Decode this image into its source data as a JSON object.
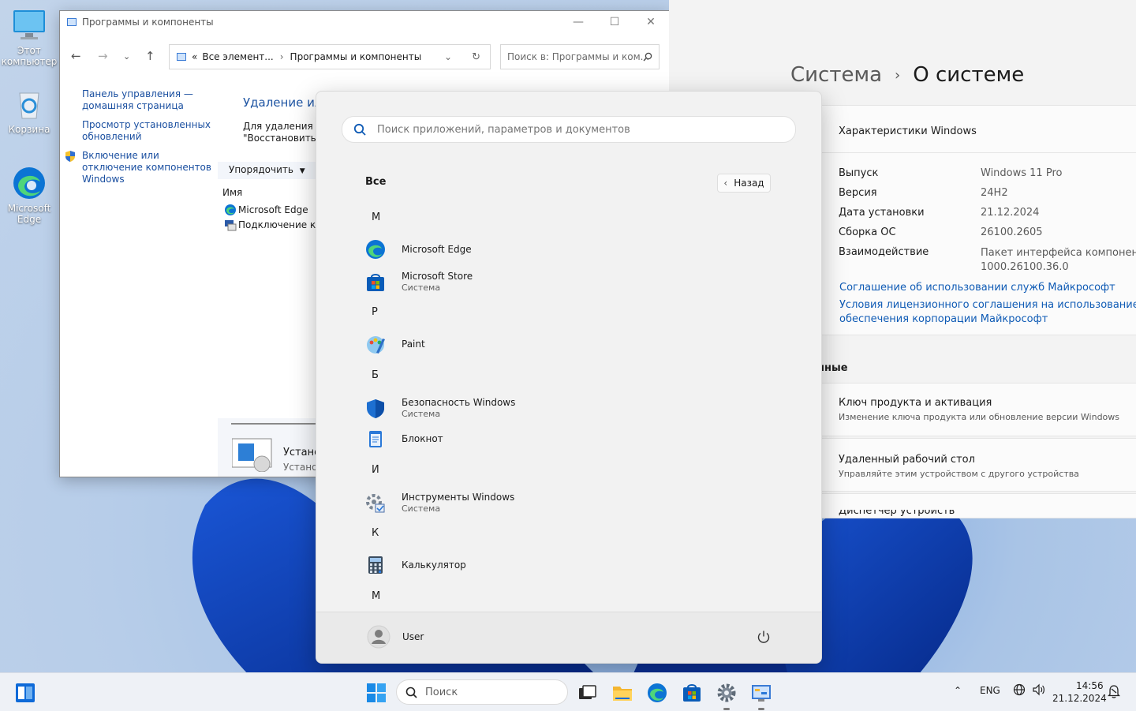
{
  "desktop": {
    "icons": [
      {
        "label": "Этот компьютер",
        "icon": "this-pc-icon"
      },
      {
        "label": "Корзина",
        "icon": "recycle-bin-icon"
      },
      {
        "label": "Microsoft Edge",
        "icon": "edge-icon"
      }
    ]
  },
  "control_panel": {
    "title": "Программы и компоненты",
    "address_prefix": "«",
    "address_crumb1": "Все элемент...",
    "address_crumb2": "Программы и компоненты",
    "search_placeholder": "Поиск в: Программы и ком...",
    "left_links": [
      "Панель управления — домашняя страница",
      "Просмотр установленных обновлений",
      "Включение или отключение компонентов Windows"
    ],
    "main_title": "Удаление или",
    "desc_line1": "Для удаления пр",
    "desc_line2": "\"Восстановить\".",
    "sort_label": "Упорядочить",
    "column_name": "Имя",
    "rows": [
      "Microsoft Edge",
      "Подключение к уд"
    ],
    "bottom_title": "Устано",
    "bottom_sub": "Установ"
  },
  "settings": {
    "crumb_parent": "Система",
    "crumb_current": "О системе",
    "specs_title": "Характеристики Windows",
    "specs": [
      {
        "label": "Выпуск",
        "value": "Windows 11 Pro"
      },
      {
        "label": "Версия",
        "value": "24H2"
      },
      {
        "label": "Дата установки",
        "value": "21.12.2024"
      },
      {
        "label": "Сборка ОС",
        "value": "26100.2605"
      },
      {
        "label": "Взаимодействие",
        "value": "Пакет интерфейса компонентов",
        "value2": "1000.26100.36.0"
      }
    ],
    "link1": "Соглашение об использовании служб Майкрософт",
    "link2a": "Условия лицензионного соглашения на использование пр",
    "link2b": "обеспечения корпорации Майкрософт",
    "related_title": "нные",
    "related": [
      {
        "title": "Ключ продукта и активация",
        "sub": "Изменение ключа продукта или обновление версии Windows"
      },
      {
        "title": "Удаленный рабочий стол",
        "sub": "Управляйте этим устройством с другого устройства"
      },
      {
        "title": "Диспетчер устройств",
        "sub": ""
      }
    ]
  },
  "start_menu": {
    "search_placeholder": "Поиск приложений, параметров и документов",
    "all_label": "Все",
    "back_label": "Назад",
    "letters": [
      "M",
      "P",
      "Б",
      "И",
      "К",
      "М"
    ],
    "apps": [
      {
        "name": "Microsoft Edge",
        "sub": "",
        "icon": "edge-icon"
      },
      {
        "name": "Microsoft Store",
        "sub": "Система",
        "icon": "store-icon"
      },
      {
        "name": "Paint",
        "sub": "",
        "icon": "paint-icon"
      },
      {
        "name": "Безопасность Windows",
        "sub": "Система",
        "icon": "shield-icon"
      },
      {
        "name": "Блокнот",
        "sub": "",
        "icon": "notepad-icon"
      },
      {
        "name": "Инструменты Windows",
        "sub": "Система",
        "icon": "tools-icon"
      },
      {
        "name": "Калькулятор",
        "sub": "",
        "icon": "calculator-icon"
      }
    ],
    "user_name": "User"
  },
  "taskbar": {
    "search_label": "Поиск",
    "language": "ENG",
    "time": "14:56",
    "date": "21.12.2024"
  },
  "colors": {
    "accent": "#0067c0",
    "link": "#0f5bb5",
    "cp_link": "#1a4fa0"
  }
}
